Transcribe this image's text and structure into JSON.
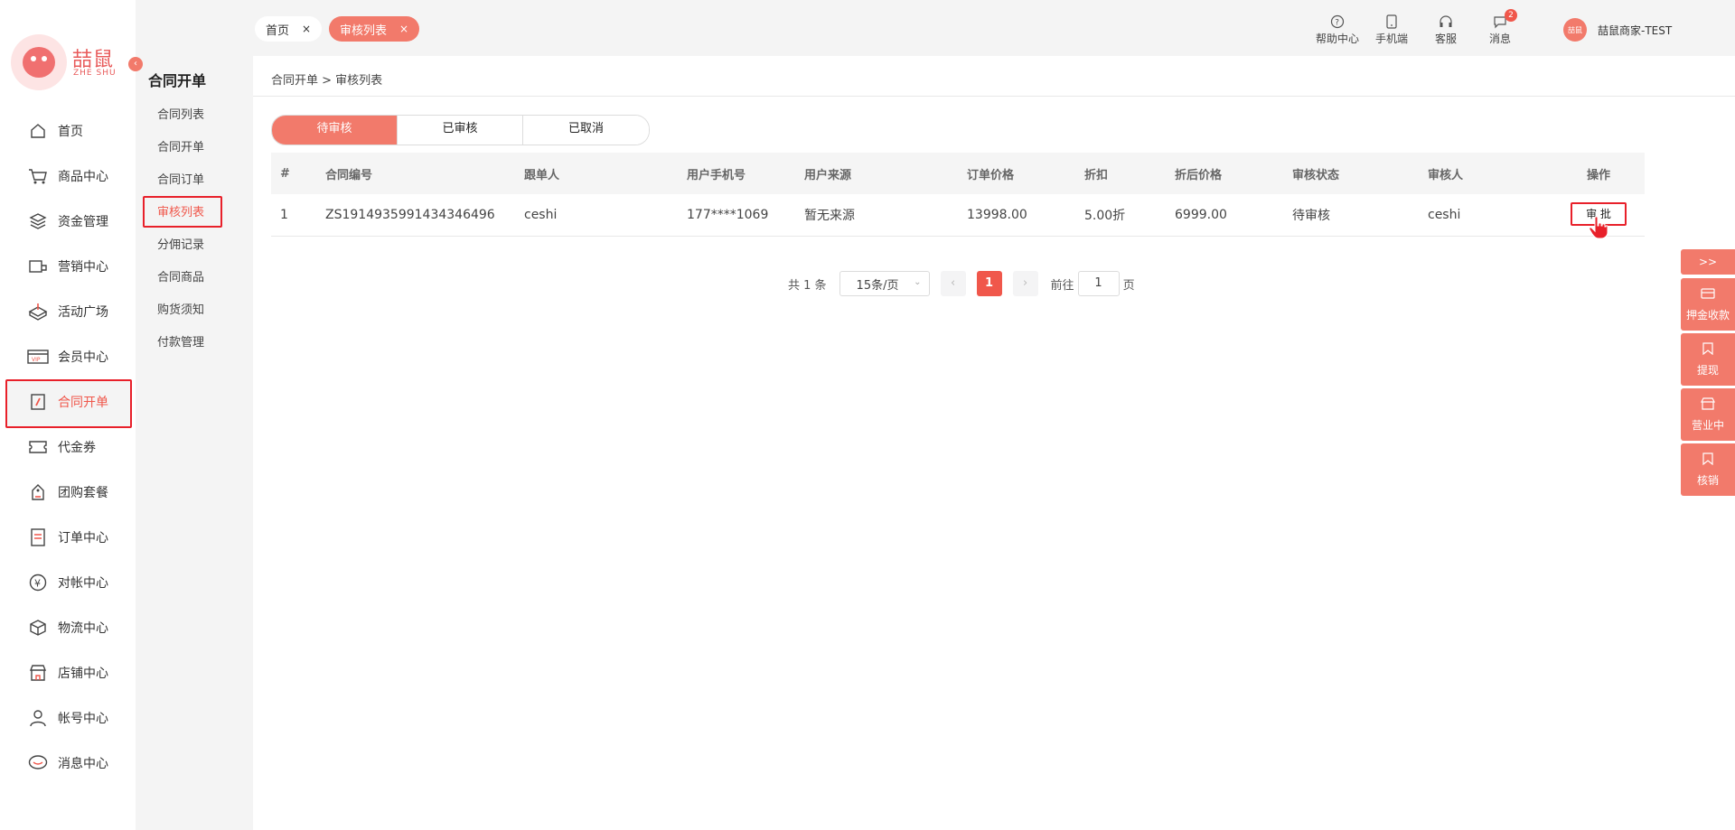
{
  "brand": {
    "logo_text": "喆鼠",
    "logo_sub": "ZHE SHU"
  },
  "sidebar": {
    "items": [
      {
        "label": "首页",
        "icon": "home-icon"
      },
      {
        "label": "商品中心",
        "icon": "cart-icon"
      },
      {
        "label": "资金管理",
        "icon": "layers-icon"
      },
      {
        "label": "营销中心",
        "icon": "marketing-icon"
      },
      {
        "label": "活动广场",
        "icon": "activity-icon"
      },
      {
        "label": "会员中心",
        "icon": "vip-icon"
      },
      {
        "label": "合同开单",
        "icon": "contract-icon",
        "active": true
      },
      {
        "label": "代金券",
        "icon": "voucher-icon"
      },
      {
        "label": "团购套餐",
        "icon": "group-buy-icon"
      },
      {
        "label": "订单中心",
        "icon": "order-icon"
      },
      {
        "label": "对帐中心",
        "icon": "yen-icon"
      },
      {
        "label": "物流中心",
        "icon": "box-icon"
      },
      {
        "label": "店铺中心",
        "icon": "store-icon"
      },
      {
        "label": "帐号中心",
        "icon": "user-icon"
      },
      {
        "label": "消息中心",
        "icon": "message-icon"
      }
    ]
  },
  "submenu": {
    "title": "合同开单",
    "items": [
      "合同列表",
      "合同开单",
      "合同订单",
      "审核列表",
      "分佣记录",
      "合同商品",
      "购货须知",
      "付款管理"
    ]
  },
  "tabs": {
    "home": "首页",
    "active": "审核列表",
    "close": "×"
  },
  "top_actions": [
    {
      "label": "帮助中心",
      "icon": "help-icon"
    },
    {
      "label": "手机端",
      "icon": "phone-icon"
    },
    {
      "label": "客服",
      "icon": "headset-icon"
    },
    {
      "label": "消息",
      "icon": "chat-icon",
      "badge": "2"
    }
  ],
  "user": {
    "name": "喆鼠商家-TEST",
    "avatar_text": "喆鼠"
  },
  "breadcrumb": "合同开单 > 审核列表",
  "status_tabs": [
    "待审核",
    "已审核",
    "已取消"
  ],
  "table": {
    "headers": [
      "#",
      "合同编号",
      "跟单人",
      "用户手机号",
      "用户来源",
      "订单价格",
      "折扣",
      "折后价格",
      "审核状态",
      "审核人",
      "操作"
    ],
    "rows": [
      [
        "1",
        "ZS1914935991434346496",
        "ceshi",
        "177****1069",
        "暂无来源",
        "13998.00",
        "5.00折",
        "6999.00",
        "待审核",
        "ceshi"
      ]
    ],
    "action_label": "审 批"
  },
  "pagination": {
    "total": "共 1 条",
    "page_size": "15条/页",
    "prev": "‹",
    "next": "›",
    "current": "1",
    "goto_label": "前往",
    "goto_value": "1",
    "page_unit": "页"
  },
  "float_right": {
    "toggle": ">>",
    "items": [
      {
        "label": "押金收款",
        "icon": "card-icon"
      },
      {
        "label": "提现",
        "icon": "bookmark-icon"
      },
      {
        "label": "营业中",
        "icon": "shop-icon"
      },
      {
        "label": "核销",
        "icon": "bookmark-icon"
      }
    ]
  },
  "colors": {
    "accent": "#f27a6b",
    "active_text": "#f0574b",
    "highlight_border": "#e8202a"
  }
}
